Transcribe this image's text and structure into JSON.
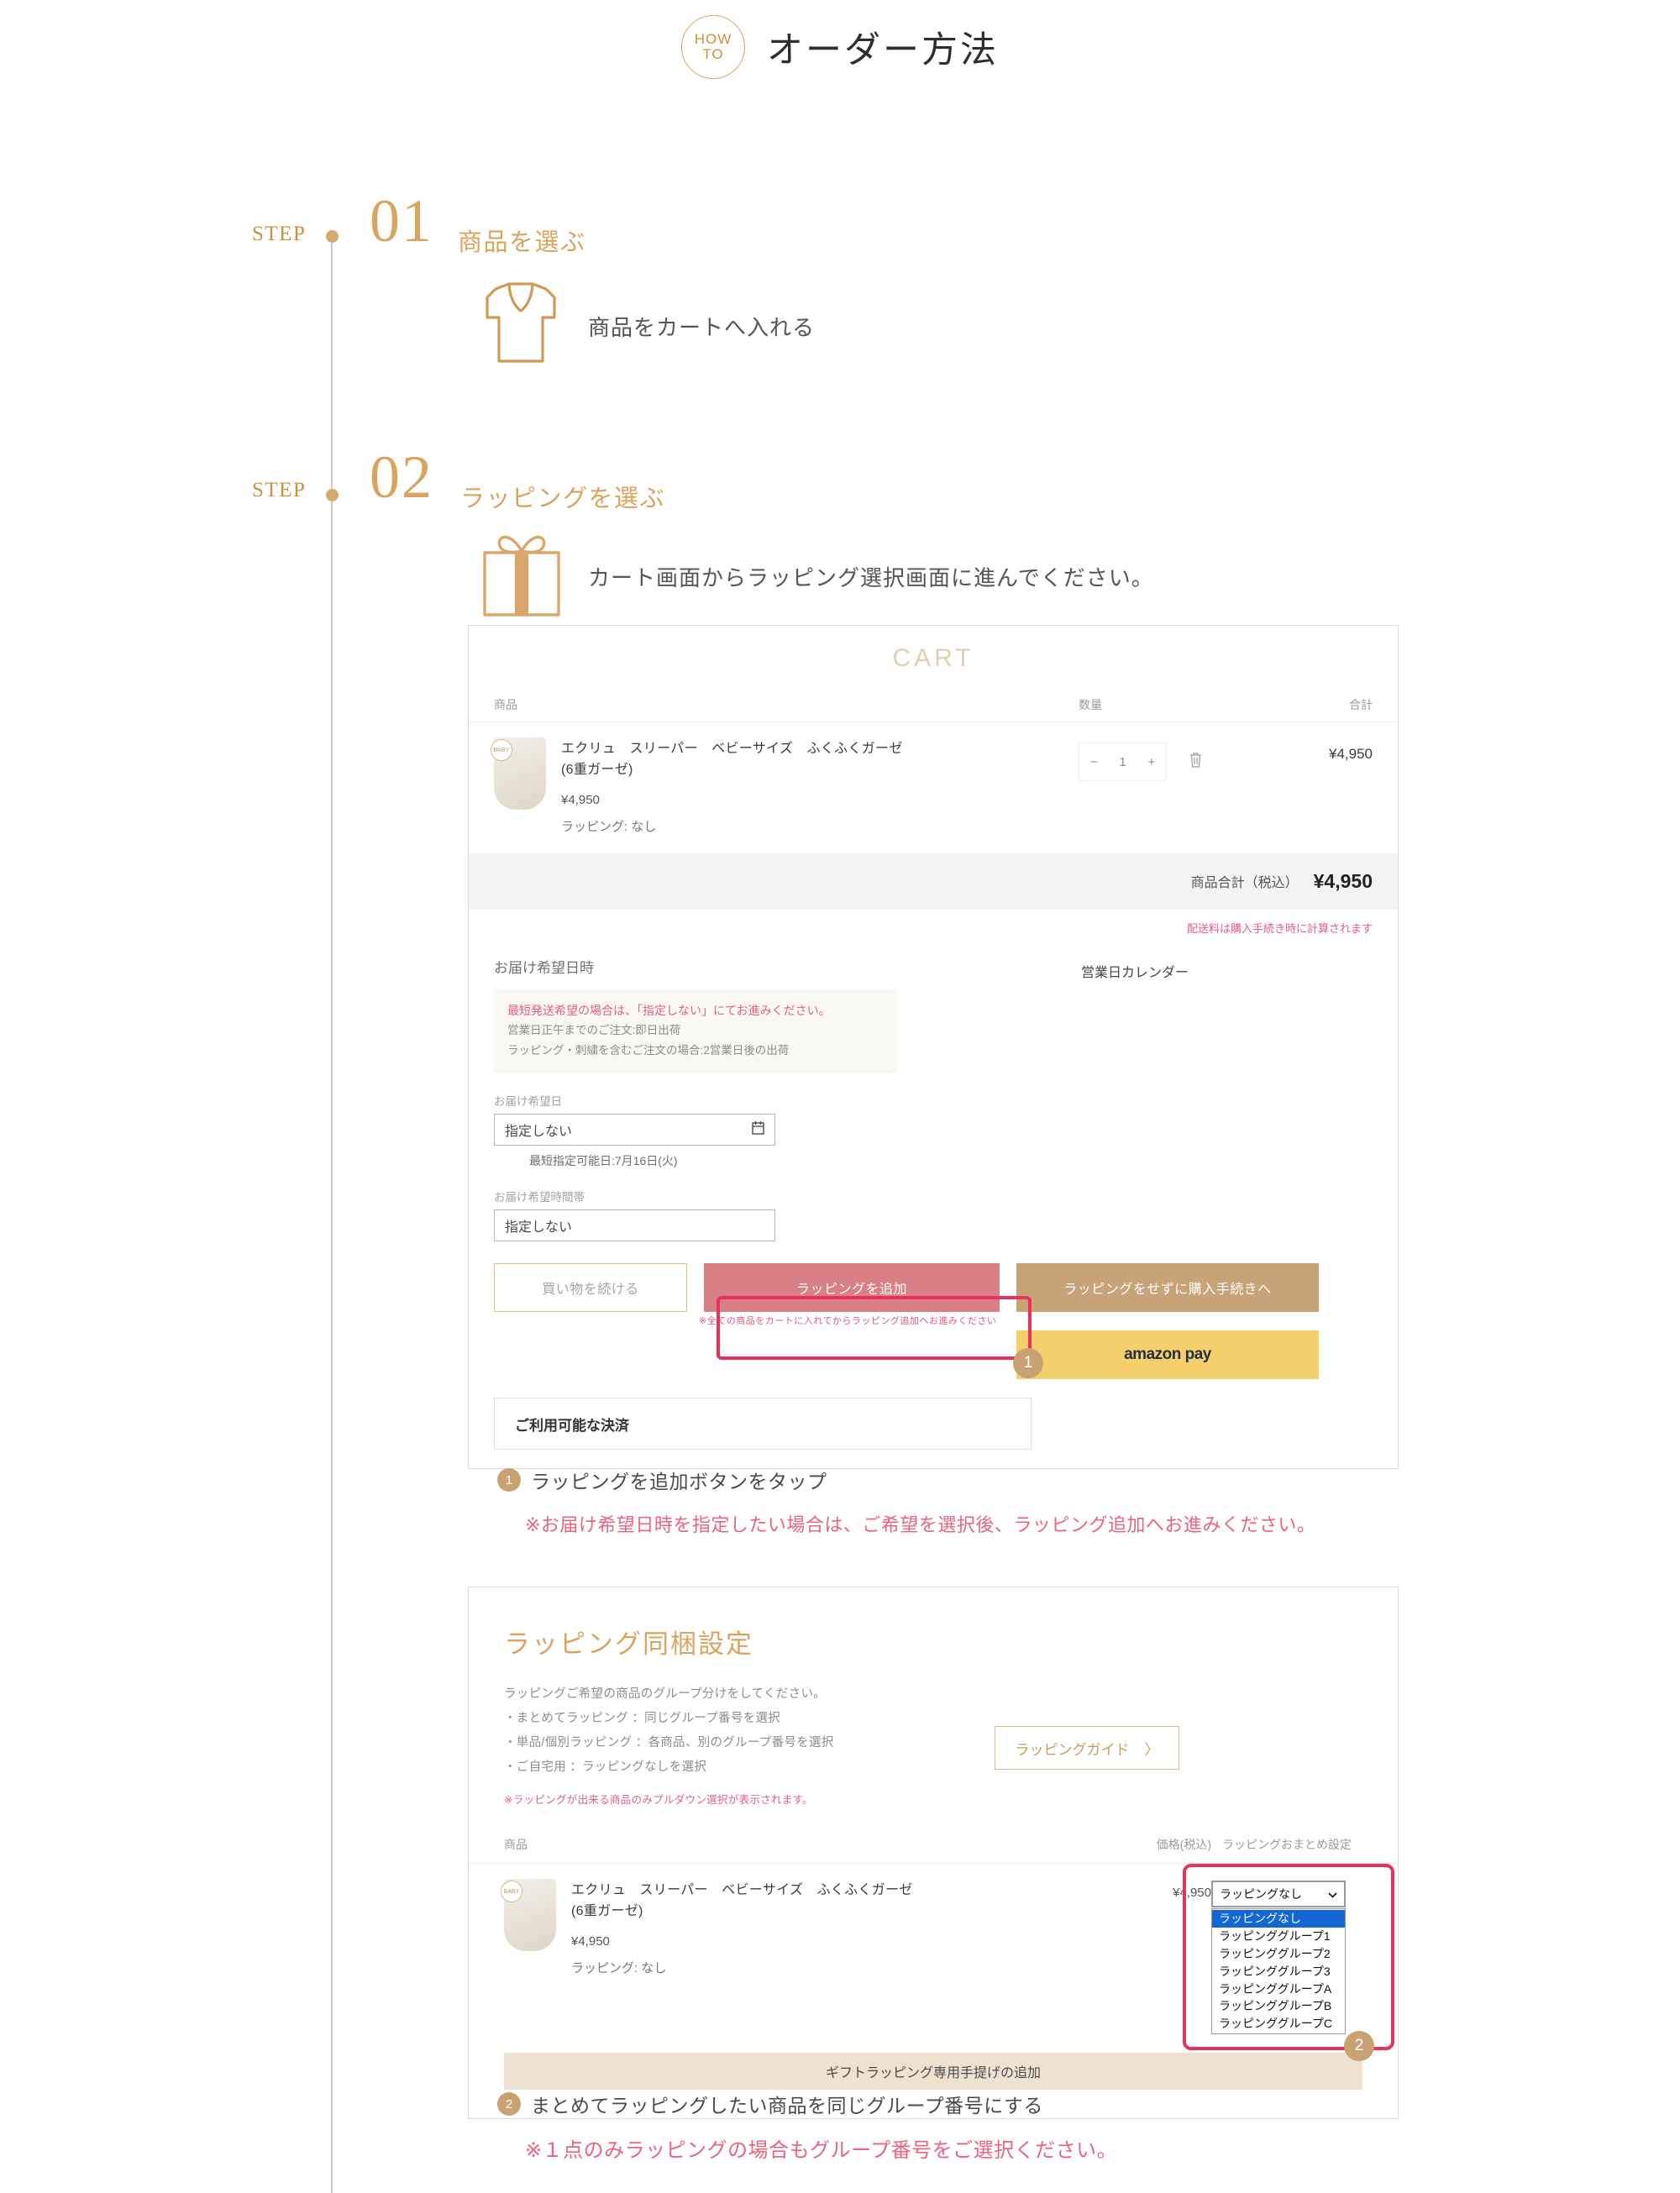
{
  "header": {
    "badge_line1": "HOW",
    "badge_line2": "TO",
    "title": "オーダー方法"
  },
  "steps": [
    {
      "label": "STEP",
      "number": "01",
      "title": "商品を選ぶ",
      "caption": "商品をカートへ入れる",
      "icon": "shirt-icon"
    },
    {
      "label": "STEP",
      "number": "02",
      "title": "ラッピングを選ぶ",
      "caption": "カート画面からラッピング選択画面に進んでください。",
      "icon": "gift-icon"
    }
  ],
  "cart": {
    "title": "CART",
    "columns": {
      "product": "商品",
      "qty": "数量",
      "total": "合計"
    },
    "item": {
      "name": "エクリュ　スリーパー　ベビーサイズ　ふくふくガーゼ(6重ガーゼ)",
      "price": "¥4,950",
      "wrapping": "ラッピング: なし",
      "qty": "1",
      "minus": "−",
      "plus": "+",
      "trash": "🗑",
      "line_total": "¥4,950",
      "badge": "BABY"
    },
    "subtotal_label": "商品合計（税込）",
    "subtotal_value": "¥4,950",
    "shipping_note": "配送料は購入手続き時に計算されます",
    "delivery_heading": "お届け希望日時",
    "business_calendar": "営業日カレンダー",
    "notice_red": "最短発送希望の場合は、「指定しない」にてお進みください。",
    "notice_line1": "営業日正午までのご注文:即日出荷",
    "notice_line2": "ラッピング・刺繍を含むご注文の場合:2営業日後の出荷",
    "date_label": "お届け希望日",
    "date_value": "指定しない",
    "date_hint": "最短指定可能日:7月16日(火)",
    "time_label": "お届け希望時間帯",
    "time_value": "指定しない",
    "btn_continue": "買い物を続ける",
    "btn_add_wrapping": "ラッピングを追加",
    "btn_add_wrapping_note": "※全ての商品をカートに入れてからラッピング追加へお進みください",
    "btn_no_wrapping": "ラッピングをせずに購入手続きへ",
    "btn_amazon": "amazon pay",
    "payment_heading": "ご利用可能な決済",
    "marker": "1"
  },
  "annotation1": {
    "bubble": "1",
    "text": "ラッピングを追加ボタンをタップ",
    "note": "※お届け希望日時を指定したい場合は、ご希望を選択後、ラッピング追加へお進みください。"
  },
  "wrapping": {
    "title": "ラッピング同梱設定",
    "desc_line1": "ラッピングご希望の商品のグループ分けをしてください。",
    "desc_line2": "・まとめてラッピング ：同じグループ番号を選択",
    "desc_line3": "・単品/個別ラッピング ：各商品、別のグループ番号を選択",
    "desc_line4": "・ご自宅用 ：ラッピングなしを選択",
    "desc_red": "※ラッピングが出来る商品のみプルダウン選択が表示されます。",
    "guide_button": "ラッピングガイド",
    "guide_chevron": "〉",
    "columns": {
      "product": "商品",
      "price": "価格(税込)",
      "setting": "ラッピングおまとめ設定"
    },
    "item": {
      "name": "エクリュ　スリーパー　ベビーサイズ　ふくふくガーゼ(6重ガーゼ)",
      "price_col": "¥4,950",
      "price": "¥4,950",
      "wrapping": "ラッピング: なし",
      "badge": "BABY"
    },
    "select_value": "ラッピングなし",
    "select_options": [
      "ラッピングなし",
      "ラッピンググループ1",
      "ラッピンググループ2",
      "ラッピンググループ3",
      "ラッピンググループA",
      "ラッピンググループB",
      "ラッピンググループC"
    ],
    "handle_bar": "ギフトラッピング専用手提げの追加",
    "marker": "2"
  },
  "annotation2": {
    "bubble": "2",
    "text": "まとめてラッピングしたい商品を同じグループ番号にする",
    "note": "※１点のみラッピングの場合もグループ番号をご選択ください。"
  },
  "colors": {
    "accent_gold": "#d9a55e",
    "accent_pink": "#e8315f",
    "button_pink": "#d98086",
    "button_tan": "#c8a378",
    "amazon_yellow": "#f5cf6c",
    "note_red": "#e2607f"
  }
}
